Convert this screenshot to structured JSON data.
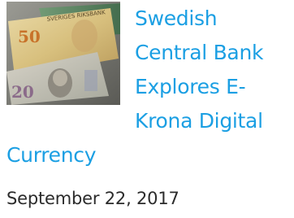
{
  "article": {
    "headline": "Swedish Central Bank Explores E-Krona Digital Currency",
    "date": "September 22, 2017",
    "thumbnail_icon": "banknotes-image"
  },
  "colors": {
    "link": "#1b9fe3",
    "date_text": "#2b2b2b"
  }
}
